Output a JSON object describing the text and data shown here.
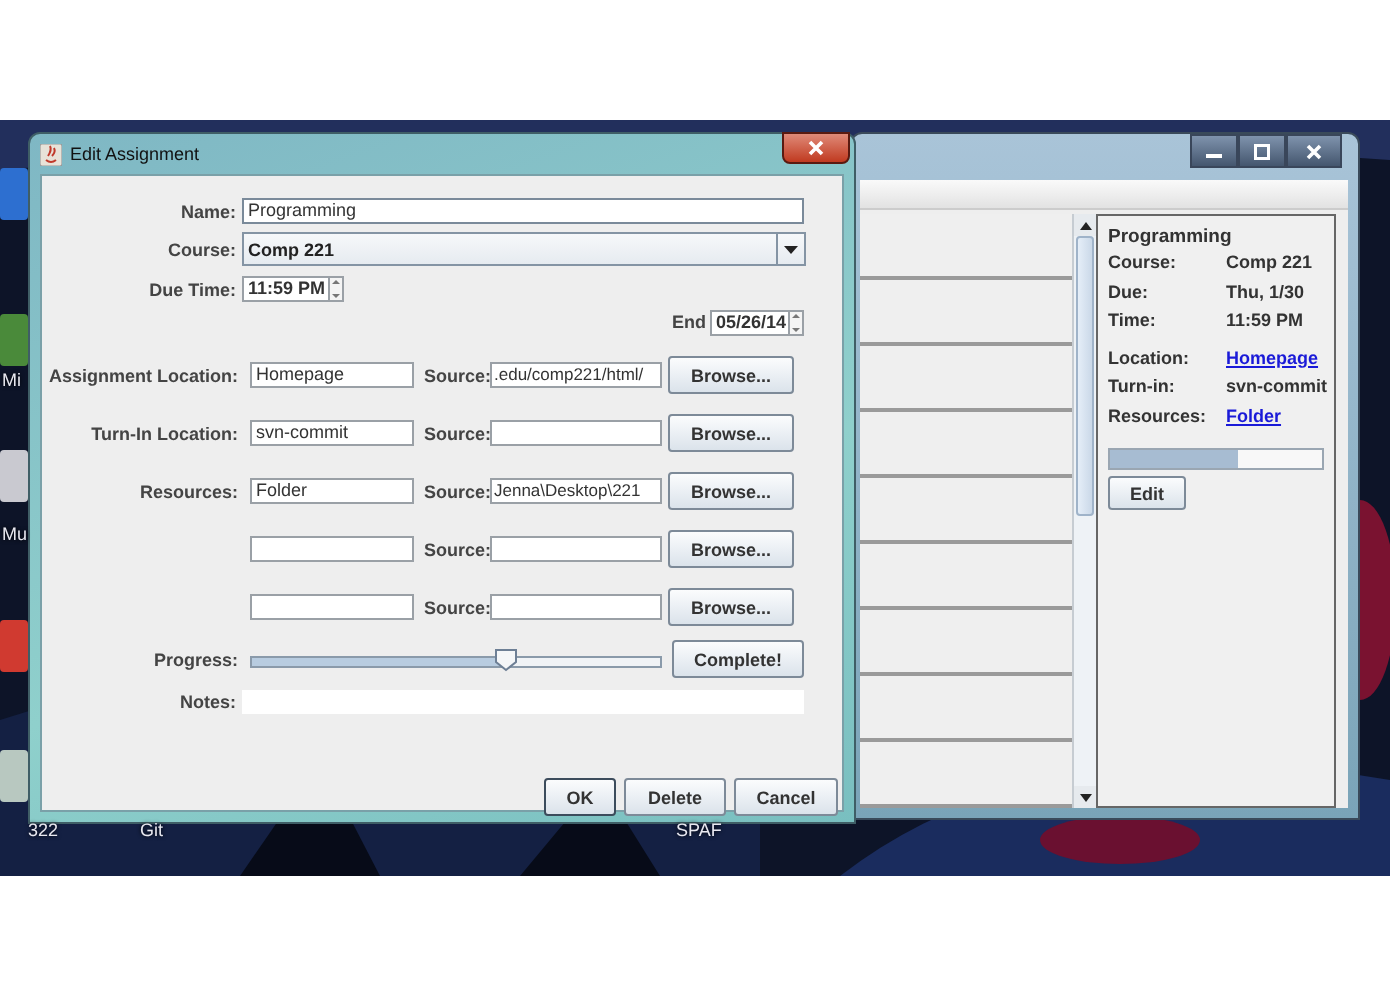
{
  "desktop": {
    "icon_labels": [
      {
        "text": "Mi",
        "kind": "side"
      },
      {
        "text": "Mu",
        "kind": "side"
      },
      {
        "text": "322",
        "kind": "bottom"
      },
      {
        "text": "Git",
        "kind": "bottom"
      },
      {
        "text": "SPAF",
        "kind": "bottom"
      }
    ]
  },
  "main_window": {
    "details": {
      "title": "Programming",
      "fields": [
        {
          "label": "Course:",
          "value": "Comp 221",
          "kind": "text"
        },
        {
          "label": "Due:",
          "value": "Thu, 1/30",
          "kind": "text"
        },
        {
          "label": "Time:",
          "value": "11:59 PM",
          "kind": "text"
        },
        {
          "label": "Location:",
          "value": "Homepage",
          "kind": "link"
        },
        {
          "label": "Turn-in:",
          "value": "svn-commit",
          "kind": "text"
        },
        {
          "label": "Resources:",
          "value": "Folder",
          "kind": "link"
        }
      ],
      "progress": {
        "level": 0.6
      },
      "edit_button": "Edit"
    }
  },
  "dialog": {
    "title": "Edit Assignment",
    "name": {
      "label": "Name:",
      "value": "Programming"
    },
    "course": {
      "label": "Course:",
      "value": "Comp 221"
    },
    "due_time": {
      "label": "Due Time:",
      "value": "11:59 PM"
    },
    "end": {
      "label": "End",
      "value": "05/26/14"
    },
    "locations": [
      {
        "label": "Assignment Location:",
        "value": "Homepage",
        "source_label": "Source:",
        "source": ".edu/comp221/html/",
        "button": "Browse..."
      },
      {
        "label": "Turn-In Location:",
        "value": "svn-commit",
        "source_label": "Source:",
        "button": "Browse..."
      },
      {
        "label": "Resources:",
        "value": "Folder",
        "source_label": "Source:",
        "source": "Jenna\\Desktop\\221",
        "button": "Browse..."
      },
      {
        "source_label": "Source:",
        "button": "Browse..."
      },
      {
        "source_label": "Source:",
        "button": "Browse..."
      }
    ],
    "progress": {
      "label": "Progress:",
      "level": 0.62,
      "button": "Complete!"
    },
    "notes": {
      "label": "Notes:"
    },
    "buttons": [
      {
        "label": "OK",
        "default": true
      },
      {
        "label": "Delete",
        "default": false
      },
      {
        "label": "Cancel",
        "default": false
      }
    ]
  }
}
